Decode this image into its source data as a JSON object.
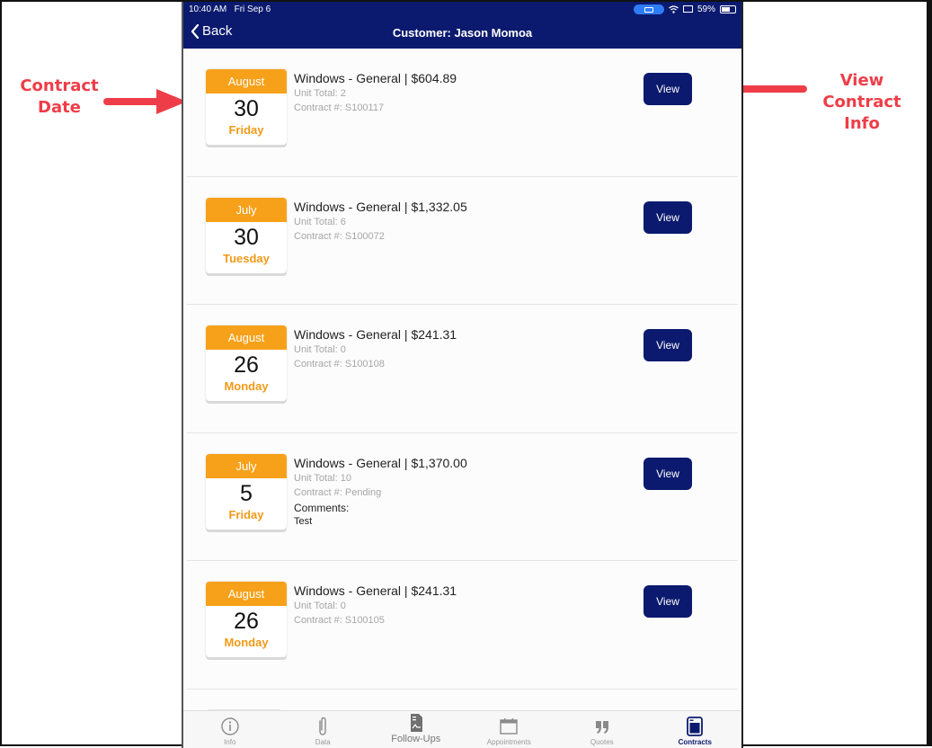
{
  "status_bar": {
    "time": "10:40 AM",
    "date": "Fri Sep 6",
    "battery": "59%",
    "icons": [
      "airplay-icon",
      "wifi-icon",
      "screen-mirror-icon",
      "battery-icon"
    ]
  },
  "header": {
    "back_label": "Back",
    "title": "Customer: Jason Momoa"
  },
  "contracts": [
    {
      "month": "August",
      "day": "30",
      "weekday": "Friday",
      "title": "Windows - General | $604.89",
      "unit_total": "Unit Total: 2",
      "contract_no": "Contract #: S100117",
      "view_label": "View"
    },
    {
      "month": "July",
      "day": "30",
      "weekday": "Tuesday",
      "title": "Windows - General | $1,332.05",
      "unit_total": "Unit Total: 6",
      "contract_no": "Contract #: S100072",
      "view_label": "View"
    },
    {
      "month": "August",
      "day": "26",
      "weekday": "Monday",
      "title": "Windows - General | $241.31",
      "unit_total": "Unit Total: 0",
      "contract_no": "Contract #: S100108",
      "view_label": "View"
    },
    {
      "month": "July",
      "day": "5",
      "weekday": "Friday",
      "title": "Windows - General | $1,370.00",
      "unit_total": "Unit Total: 10",
      "contract_no": "Contract #: Pending",
      "comments_label": "Comments:",
      "comments": "Test",
      "view_label": "View"
    },
    {
      "month": "August",
      "day": "26",
      "weekday": "Monday",
      "title": "Windows - General | $241.31",
      "unit_total": "Unit Total: 0",
      "contract_no": "Contract #: S100105",
      "view_label": "View"
    }
  ],
  "tabbar": {
    "items": [
      {
        "label": "Info",
        "icon": "info-icon"
      },
      {
        "label": "Data",
        "icon": "paperclip-icon"
      },
      {
        "label": "Follow-Ups",
        "icon": "document-icon"
      },
      {
        "label": "Appointments",
        "icon": "calendar-icon"
      },
      {
        "label": "Quotes",
        "icon": "quote-icon"
      },
      {
        "label": "Contracts",
        "icon": "contract-icon",
        "active": true
      }
    ]
  },
  "annotations": {
    "left": "Contract\nDate",
    "left_line1": "Contract",
    "left_line2": "Date",
    "right_line1": "View",
    "right_line2": "Contract Info"
  },
  "colors": {
    "header_bg": "#0b1a6e",
    "calendar_accent": "#f7a11a",
    "annotation_red": "#ee3d48"
  }
}
